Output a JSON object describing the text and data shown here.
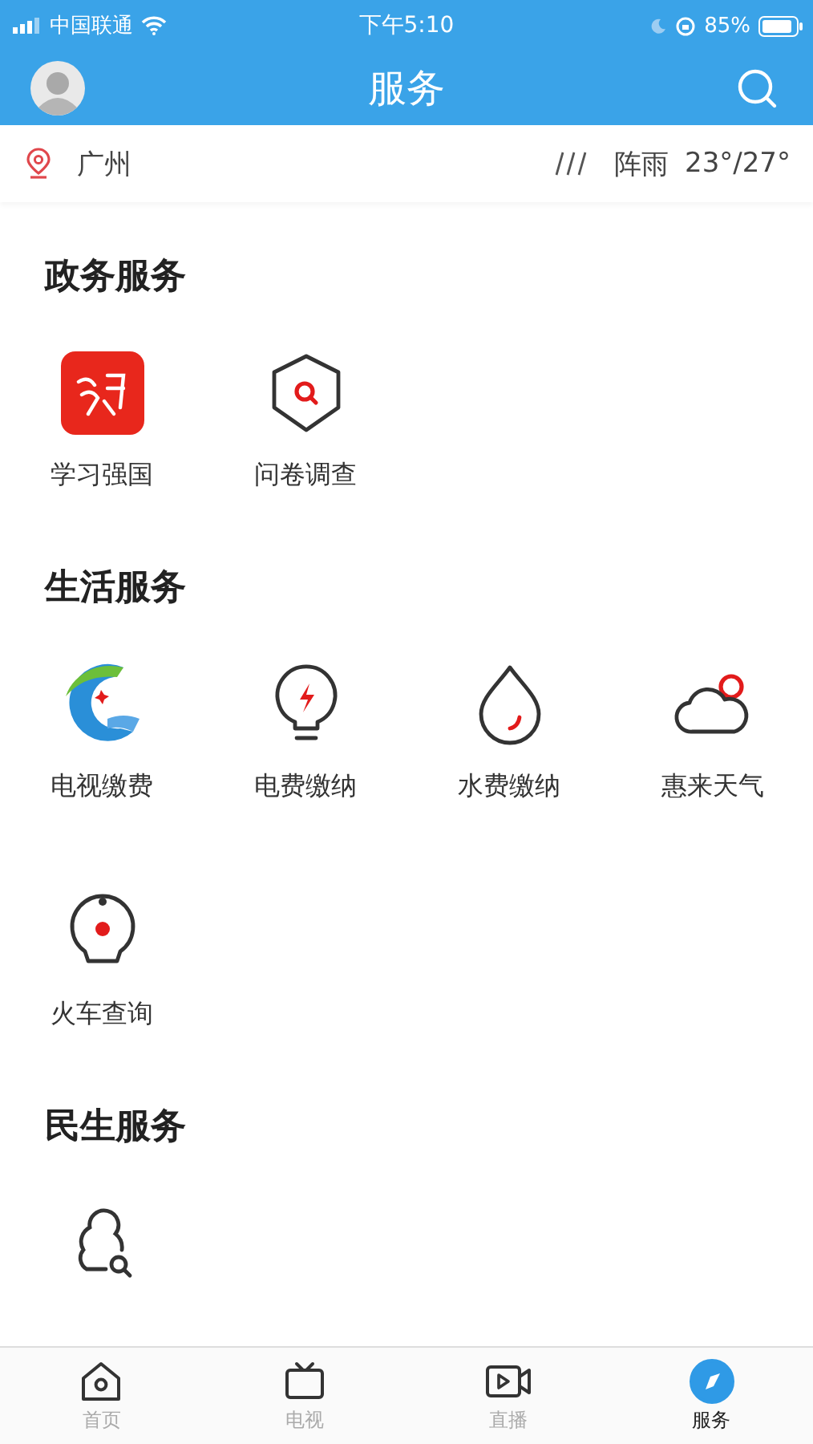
{
  "status_bar": {
    "carrier": "中国联通",
    "time": "下午5:10",
    "battery": "85%"
  },
  "header": {
    "title": "服务"
  },
  "location_bar": {
    "city": "广州",
    "weather": "阵雨",
    "temperature": "23°/27°"
  },
  "sections": [
    {
      "title": "政务服务",
      "items": [
        {
          "label": "学习强国",
          "kind": "xuexi"
        },
        {
          "label": "问卷调查",
          "kind": "shield"
        }
      ]
    },
    {
      "title": "生活服务",
      "items": [
        {
          "label": "电视缴费",
          "kind": "tvlogo"
        },
        {
          "label": "电费缴纳",
          "kind": "bulb"
        },
        {
          "label": "水费缴纳",
          "kind": "drop"
        },
        {
          "label": "惠来天气",
          "kind": "cloud"
        },
        {
          "label": "火车查询",
          "kind": "train"
        }
      ]
    },
    {
      "title": "民生服务",
      "items": [
        {
          "kind": "person"
        }
      ]
    }
  ],
  "tabs": [
    {
      "label": "首页",
      "kind": "home",
      "selected": false
    },
    {
      "label": "电视",
      "kind": "tv",
      "selected": false
    },
    {
      "label": "直播",
      "kind": "video",
      "selected": false
    },
    {
      "label": "服务",
      "kind": "compass",
      "selected": true
    }
  ]
}
